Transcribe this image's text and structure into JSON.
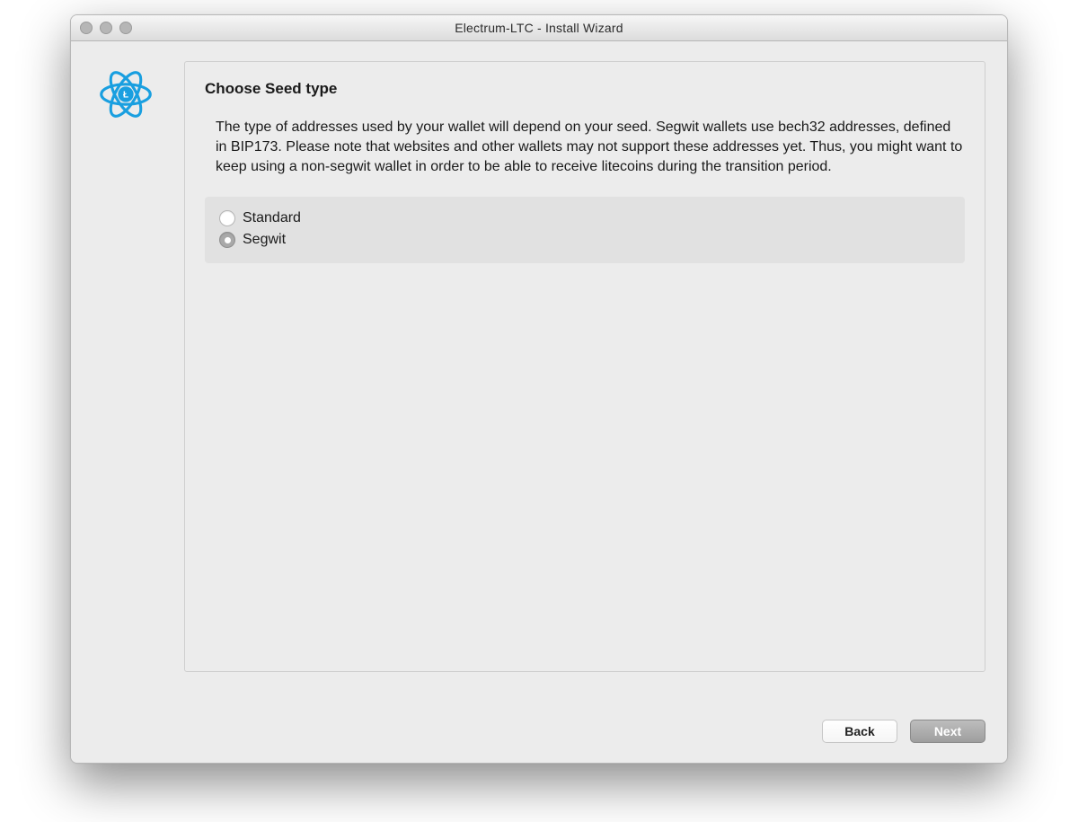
{
  "window": {
    "title": "Electrum-LTC  -  Install Wizard"
  },
  "logo": {
    "name": "electrum-ltc-logo",
    "color": "#199fe0",
    "letter": "Ł"
  },
  "content": {
    "heading": "Choose Seed type",
    "description": "The type of addresses used by your wallet will depend on your seed. Segwit wallets use bech32 addresses, defined in BIP173. Please note that websites and other wallets may not support these addresses yet. Thus, you might want to keep using a non-segwit wallet in order to be able to receive litecoins during the transition period."
  },
  "options": [
    {
      "label": "Standard",
      "selected": false
    },
    {
      "label": "Segwit",
      "selected": true
    }
  ],
  "buttons": {
    "back": "Back",
    "next": "Next"
  }
}
